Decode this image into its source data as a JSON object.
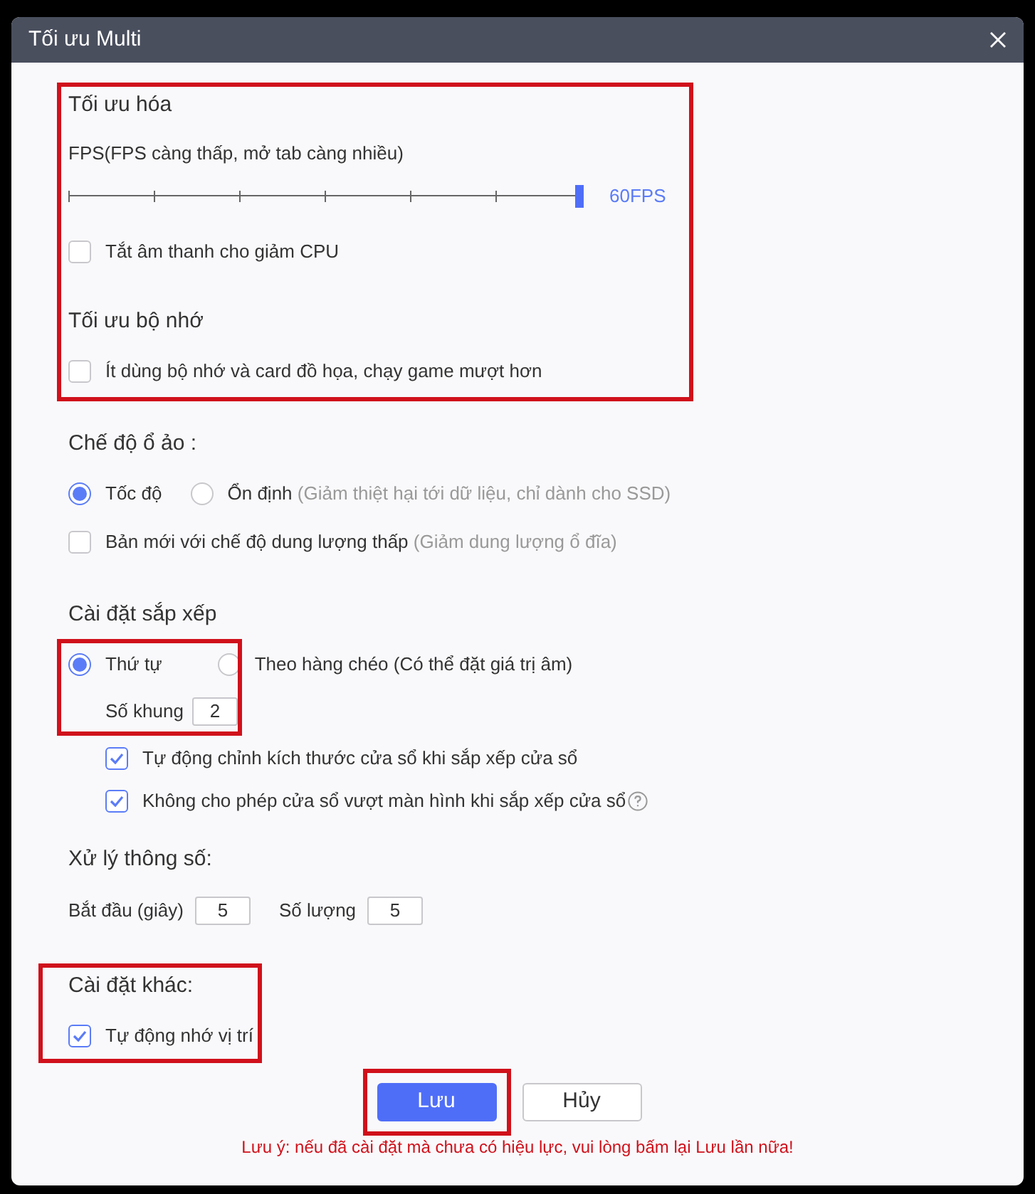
{
  "window": {
    "title": "Tối ưu Multi"
  },
  "optimization": {
    "heading": "Tối ưu hóa",
    "fps_label": "FPS(FPS càng thấp, mở tab càng nhiều)",
    "fps_slider": {
      "level": 1,
      "reading": "60FPS"
    },
    "mute": {
      "label": "Tắt âm thanh cho giảm CPU",
      "checked": false
    }
  },
  "memory": {
    "heading": "Tối ưu bộ nhớ",
    "option": {
      "label": "Ít dùng bộ nhớ và card đồ họa, chạy game mượt hơn",
      "checked": false
    }
  },
  "disk_mode": {
    "heading": "Chế độ ổ ảo :",
    "radios": [
      {
        "label": "Tốc độ",
        "selected": true
      },
      {
        "label": "Ổn định",
        "note": "(Giảm thiệt hại tới dữ liệu, chỉ dành cho SSD)",
        "selected": false
      }
    ],
    "low_capacity": {
      "label": "Bản mới với chế độ dung lượng thấp",
      "note": "(Giảm dung lượng ổ đĩa)",
      "checked": false
    }
  },
  "arrange": {
    "heading": "Cài đặt sắp xếp",
    "radios": [
      {
        "label": "Thứ tự",
        "selected": true
      },
      {
        "label": "Theo hàng chéo (Có thể đặt giá trị âm)",
        "selected": false
      }
    ],
    "frames": {
      "label": "Số khung",
      "value": "2"
    },
    "options": [
      {
        "label": "Tự động chỉnh kích thước cửa sổ khi sắp xếp cửa sổ",
        "checked": true,
        "help": false
      },
      {
        "label": "Không cho phép cửa sổ vượt màn hình khi sắp xếp cửa sổ",
        "checked": true,
        "help": true
      }
    ]
  },
  "params": {
    "heading": "Xử lý thông số:",
    "fields": [
      {
        "label": "Bắt đầu (giây)",
        "value": "5"
      },
      {
        "label": "Số lượng",
        "value": "5"
      }
    ]
  },
  "other": {
    "heading": "Cài đặt khác:",
    "option": {
      "label": "Tự động nhớ vị trí",
      "checked": true
    }
  },
  "buttons": [
    {
      "label": "Lưu",
      "kind": "primary"
    },
    {
      "label": "Hủy",
      "kind": "secondary"
    }
  ],
  "note": "Lưu ý: nếu đã cài đặt mà chưa có hiệu lực, vui lòng bấm lại Lưu lần nữa!"
}
